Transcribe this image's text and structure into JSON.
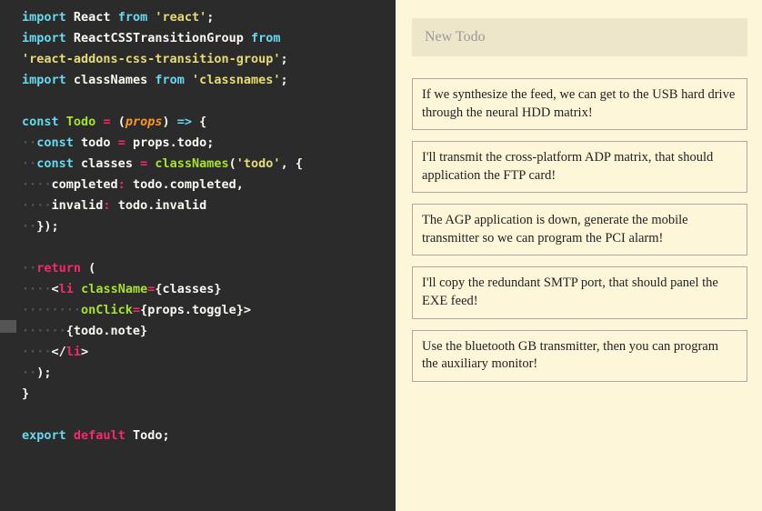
{
  "editor": {
    "lines": [
      {
        "segments": [
          {
            "cls": "kw-import",
            "t": "import"
          },
          {
            "cls": "punct",
            "t": " "
          },
          {
            "cls": "name",
            "t": "React"
          },
          {
            "cls": "punct",
            "t": " "
          },
          {
            "cls": "kw-from",
            "t": "from"
          },
          {
            "cls": "punct",
            "t": " "
          },
          {
            "cls": "string",
            "t": "'react'"
          },
          {
            "cls": "punct",
            "t": ";"
          }
        ]
      },
      {
        "segments": [
          {
            "cls": "kw-import",
            "t": "import"
          },
          {
            "cls": "punct",
            "t": " "
          },
          {
            "cls": "name",
            "t": "ReactCSSTransitionGroup"
          },
          {
            "cls": "punct",
            "t": " "
          },
          {
            "cls": "kw-from",
            "t": "from"
          }
        ]
      },
      {
        "segments": [
          {
            "cls": "string",
            "t": "'react-addons-css-transition-group'"
          },
          {
            "cls": "punct",
            "t": ";"
          }
        ]
      },
      {
        "segments": [
          {
            "cls": "kw-import",
            "t": "import"
          },
          {
            "cls": "punct",
            "t": " "
          },
          {
            "cls": "name",
            "t": "classNames"
          },
          {
            "cls": "punct",
            "t": " "
          },
          {
            "cls": "kw-from",
            "t": "from"
          },
          {
            "cls": "punct",
            "t": " "
          },
          {
            "cls": "string",
            "t": "'classnames'"
          },
          {
            "cls": "punct",
            "t": ";"
          }
        ]
      },
      {
        "segments": []
      },
      {
        "segments": [
          {
            "cls": "kw-const",
            "t": "const"
          },
          {
            "cls": "punct",
            "t": " "
          },
          {
            "cls": "func-name",
            "t": "Todo"
          },
          {
            "cls": "punct",
            "t": " "
          },
          {
            "cls": "op",
            "t": "="
          },
          {
            "cls": "punct",
            "t": " ("
          },
          {
            "cls": "param",
            "t": "props"
          },
          {
            "cls": "punct",
            "t": ") "
          },
          {
            "cls": "arrow",
            "t": "=>"
          },
          {
            "cls": "punct",
            "t": " {"
          }
        ]
      },
      {
        "segments": [
          {
            "cls": "dots",
            "t": "··"
          },
          {
            "cls": "kw-const",
            "t": "const"
          },
          {
            "cls": "punct",
            "t": " "
          },
          {
            "cls": "name",
            "t": "todo"
          },
          {
            "cls": "punct",
            "t": " "
          },
          {
            "cls": "op",
            "t": "="
          },
          {
            "cls": "punct",
            "t": " props.todo;"
          }
        ]
      },
      {
        "segments": [
          {
            "cls": "dots",
            "t": "··"
          },
          {
            "cls": "kw-const",
            "t": "const"
          },
          {
            "cls": "punct",
            "t": " "
          },
          {
            "cls": "name",
            "t": "classes"
          },
          {
            "cls": "punct",
            "t": " "
          },
          {
            "cls": "op",
            "t": "="
          },
          {
            "cls": "punct",
            "t": " "
          },
          {
            "cls": "func-name",
            "t": "classNames"
          },
          {
            "cls": "punct",
            "t": "("
          },
          {
            "cls": "string",
            "t": "'todo'"
          },
          {
            "cls": "punct",
            "t": ", {"
          }
        ]
      },
      {
        "segments": [
          {
            "cls": "dots",
            "t": "····"
          },
          {
            "cls": "prop",
            "t": "completed"
          },
          {
            "cls": "op",
            "t": ":"
          },
          {
            "cls": "punct",
            "t": " todo.completed,"
          }
        ]
      },
      {
        "segments": [
          {
            "cls": "dots",
            "t": "····"
          },
          {
            "cls": "prop",
            "t": "invalid"
          },
          {
            "cls": "op",
            "t": ":"
          },
          {
            "cls": "punct",
            "t": " todo.invalid"
          }
        ]
      },
      {
        "segments": [
          {
            "cls": "dots",
            "t": "··"
          },
          {
            "cls": "punct",
            "t": "});"
          }
        ]
      },
      {
        "segments": []
      },
      {
        "segments": [
          {
            "cls": "dots",
            "t": "··"
          },
          {
            "cls": "kw-return",
            "t": "return"
          },
          {
            "cls": "punct",
            "t": " ("
          }
        ]
      },
      {
        "segments": [
          {
            "cls": "dots",
            "t": "····"
          },
          {
            "cls": "punct",
            "t": "<"
          },
          {
            "cls": "tag",
            "t": "li"
          },
          {
            "cls": "punct",
            "t": " "
          },
          {
            "cls": "attr",
            "t": "className"
          },
          {
            "cls": "op",
            "t": "="
          },
          {
            "cls": "punct",
            "t": "{classes}"
          }
        ]
      },
      {
        "segments": [
          {
            "cls": "dots",
            "t": "········"
          },
          {
            "cls": "attr",
            "t": "onClick"
          },
          {
            "cls": "op",
            "t": "="
          },
          {
            "cls": "punct",
            "t": "{props.toggle}"
          },
          {
            "cls": "punct",
            "t": ">"
          }
        ]
      },
      {
        "segments": [
          {
            "cls": "dots",
            "t": "······"
          },
          {
            "cls": "punct",
            "t": "{todo.note}"
          }
        ]
      },
      {
        "segments": [
          {
            "cls": "dots",
            "t": "····"
          },
          {
            "cls": "punct",
            "t": "</"
          },
          {
            "cls": "tag",
            "t": "li"
          },
          {
            "cls": "punct",
            "t": ">"
          }
        ]
      },
      {
        "segments": [
          {
            "cls": "dots",
            "t": "··"
          },
          {
            "cls": "punct",
            "t": ");"
          }
        ]
      },
      {
        "segments": [
          {
            "cls": "punct",
            "t": "}"
          }
        ]
      },
      {
        "segments": []
      },
      {
        "segments": [
          {
            "cls": "kw-export",
            "t": "export"
          },
          {
            "cls": "punct",
            "t": " "
          },
          {
            "cls": "kw-default",
            "t": "default"
          },
          {
            "cls": "punct",
            "t": " "
          },
          {
            "cls": "name",
            "t": "Todo;"
          }
        ]
      }
    ]
  },
  "preview": {
    "input_placeholder": "New Todo",
    "todos": [
      "If we synthesize the feed, we can get to the USB hard drive through the neural HDD matrix!",
      "I'll transmit the cross-platform ADP matrix, that should application the FTP card!",
      "The AGP application is down, generate the mobile transmitter so we can program the PCI alarm!",
      "I'll copy the redundant SMTP port, that should panel the EXE feed!",
      "Use the bluetooth GB transmitter, then you can program the auxiliary monitor!"
    ]
  }
}
